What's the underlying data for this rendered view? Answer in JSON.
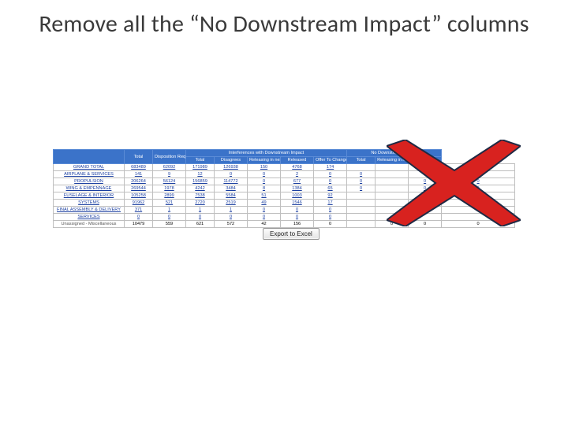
{
  "title": "Remove all the “No Downstream Impact” columns",
  "chart_data": {
    "type": "table",
    "headers": {
      "blank": "",
      "total": "Total",
      "disposition": "Disposition Required",
      "group_interf": "Interferences with Downstream Impact",
      "i_total": "Total",
      "i_disagrees": "Disagrees",
      "i_releasing7": "Releasing in next 7 days",
      "i_released": "Released",
      "i_offer": "Offer To Change",
      "group_nodown": "No Downstream Impact",
      "n_total": "Total",
      "n_releasing7": "Releasing in next 7 days",
      "n_released": "Released"
    },
    "rows": [
      {
        "label": "GRAND TOTAL",
        "link": true,
        "vals": [
          "683489",
          "62092",
          "171989",
          "126938",
          "150",
          "4768",
          "174",
          "",
          "",
          "",
          ""
        ]
      },
      {
        "label": "AIRPLANE & SERVICES",
        "link": true,
        "vals": [
          "141",
          "9",
          "12",
          "0",
          "0",
          "2",
          "0",
          "0",
          "",
          "",
          ""
        ]
      },
      {
        "label": "PROPULSION",
        "link": true,
        "vals": [
          "206264",
          "56124",
          "156859",
          "114772",
          "0",
          "677",
          "0",
          "0",
          "",
          "0",
          "0"
        ]
      },
      {
        "label": "WING & EMPENNAGE",
        "link": true,
        "vals": [
          "269544",
          "1978",
          "4242",
          "3484",
          "8",
          "1384",
          "65",
          "0",
          "",
          "0",
          "0"
        ]
      },
      {
        "label": "FUSELAGE & INTERIOR",
        "link": true,
        "vals": [
          "105258",
          "2899",
          "7538",
          "5584",
          "51",
          "1003",
          "92",
          "",
          "",
          "",
          ""
        ]
      },
      {
        "label": "SYSTEMS",
        "link": true,
        "vals": [
          "91962",
          "521",
          "2720",
          "2519",
          "49",
          "1546",
          "17",
          "",
          "",
          "",
          ""
        ]
      },
      {
        "label": "FINAL ASSEMBLY & DELIVERY",
        "link": true,
        "vals": [
          "371",
          "1",
          "1",
          "1",
          "0",
          "0",
          "0",
          "",
          "",
          "0",
          ""
        ]
      },
      {
        "label": "SERVICES",
        "link": true,
        "vals": [
          "0",
          "0",
          "0",
          "0",
          "0",
          "0",
          "0",
          "",
          "",
          "",
          ""
        ]
      },
      {
        "label": "Unassigned - Miscellaneous",
        "link": false,
        "vals": [
          "10479",
          "559",
          "621",
          "572",
          "42",
          "156",
          "0",
          "",
          "0",
          "0",
          "0"
        ]
      }
    ]
  },
  "export_label": "Export to Excel",
  "colors": {
    "header_bg": "#3b73c9",
    "cross_fill": "#d8221f",
    "cross_stroke": "#1f2a44"
  }
}
